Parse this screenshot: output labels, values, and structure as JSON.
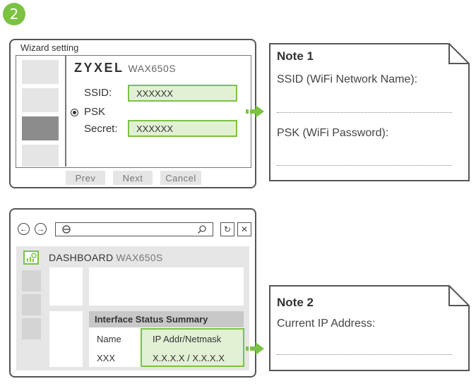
{
  "step": {
    "number": "2"
  },
  "wizard": {
    "title": "Wizard setting",
    "brand": "ZYXEL",
    "model": "WAX650S",
    "ssid_label": "SSID:",
    "ssid_value": "XXXXXX",
    "psk_label": "PSK",
    "secret_label": "Secret:",
    "secret_value": "XXXXXX",
    "buttons": {
      "prev": "Prev",
      "next": "Next",
      "cancel": "Cancel"
    }
  },
  "note1": {
    "title": "Note 1",
    "ssid_line": "SSID (WiFi Network Name):",
    "psk_line": "PSK (WiFi Password):"
  },
  "browser": {
    "dashboard_label": "DASHBOARD",
    "model": "WAX650S",
    "table_title": "Interface Status Summary",
    "col_name": "Name",
    "col_ip": "IP Addr/Netmask",
    "row_name": "XXX",
    "row_ip": "X.X.X.X / X.X.X.X"
  },
  "note2": {
    "title": "Note 2",
    "ip_line": "Current IP Address:"
  },
  "colors": {
    "accent": "#7bc243",
    "field_fill": "#e2f1d3"
  }
}
